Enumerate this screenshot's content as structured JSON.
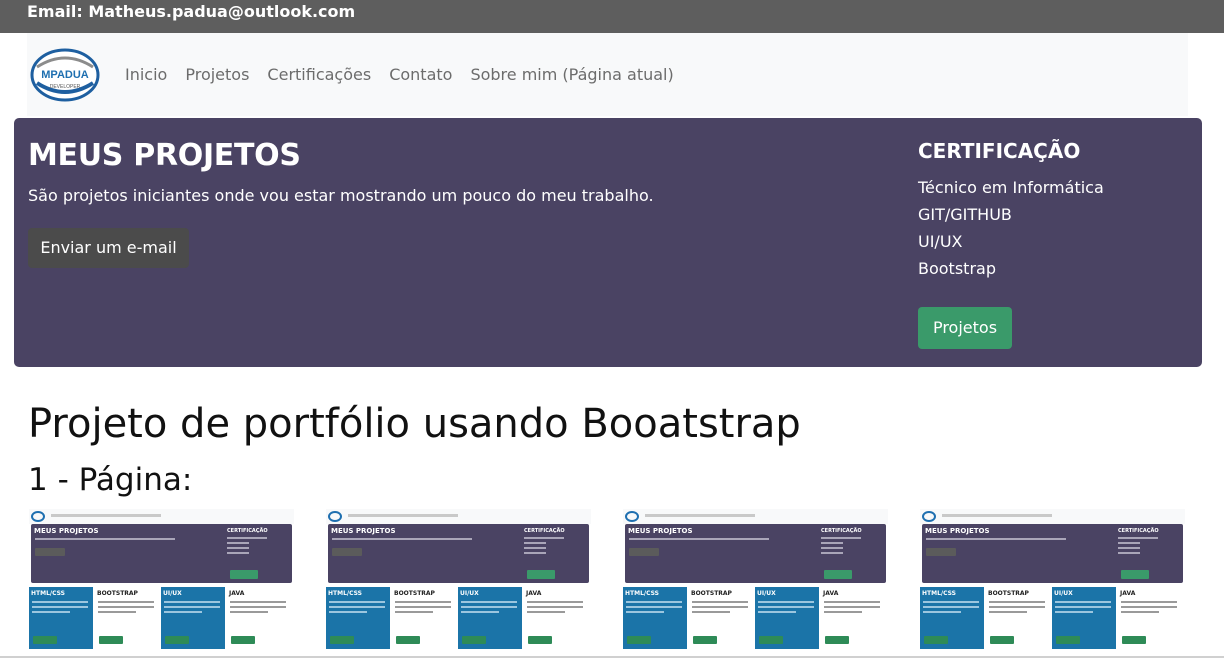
{
  "topbar": {
    "email_label": "Email: Matheus.padua@outlook.com"
  },
  "navbar": {
    "logo_text": "MPADUA",
    "logo_subtext": "DEVELOPER",
    "links": [
      "Inicio",
      "Projetos",
      "Certificações",
      "Contato",
      "Sobre mim (Página atual)"
    ]
  },
  "hero": {
    "title": "MEUS PROJETOS",
    "subtitle": "São projetos iniciantes onde vou estar mostrando um pouco do meu trabalho.",
    "email_button": "Enviar um e-mail",
    "cert_title": "CERTIFICAÇÃO",
    "cert_items": [
      "Técnico em Informática",
      "GIT/GITHUB",
      "UI/UX",
      "Bootstrap"
    ],
    "projects_button": "Projetos"
  },
  "main": {
    "title": "Projeto de portfólio usando Booatstrap",
    "subtitle": "1 - Página:"
  },
  "colors": {
    "topbar": "#5e5e5e",
    "hero_bg": "#4a4363",
    "button_gray": "#4b4b4b",
    "button_green": "#3a9a6a",
    "card_blue": "#1b74a8"
  }
}
